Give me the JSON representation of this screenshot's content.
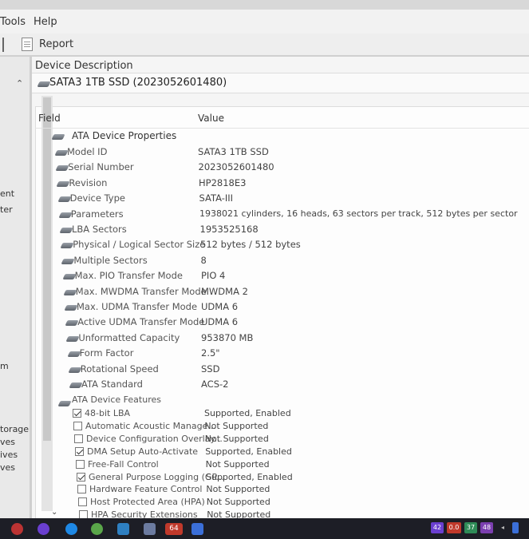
{
  "menubar": {
    "tools": "Tools",
    "help": "Help"
  },
  "toolbar": {
    "report_label": "Report"
  },
  "left_pane": {
    "fragments": [
      "ent",
      "ter",
      "m",
      "torage",
      "ves",
      "ives",
      "ves"
    ]
  },
  "device_description": {
    "title": "Device Description",
    "value": "SATA3 1TB SSD (2023052601480)"
  },
  "table": {
    "headers": {
      "field": "Field",
      "value": "Value"
    },
    "group_properties": "ATA Device Properties",
    "properties": [
      {
        "field": "Model ID",
        "value": "SATA3 1TB SSD"
      },
      {
        "field": "Serial Number",
        "value": "2023052601480"
      },
      {
        "field": "Revision",
        "value": "HP2818E3"
      },
      {
        "field": "Device Type",
        "value": "SATA-III"
      },
      {
        "field": "Parameters",
        "value": "1938021 cylinders, 16 heads, 63 sectors per track, 512 bytes per sector"
      },
      {
        "field": "LBA Sectors",
        "value": "1953525168"
      },
      {
        "field": "Physical / Logical Sector Size",
        "value": "512 bytes / 512 bytes"
      },
      {
        "field": "Multiple Sectors",
        "value": "8"
      },
      {
        "field": "Max. PIO Transfer Mode",
        "value": "PIO 4"
      },
      {
        "field": "Max. MWDMA Transfer Mode",
        "value": "MWDMA 2"
      },
      {
        "field": "Max. UDMA Transfer Mode",
        "value": "UDMA 6"
      },
      {
        "field": "Active UDMA Transfer Mode",
        "value": "UDMA 6"
      },
      {
        "field": "Unformatted Capacity",
        "value": "953870 MB"
      },
      {
        "field": "Form Factor",
        "value": "2.5\""
      },
      {
        "field": "Rotational Speed",
        "value": "SSD"
      },
      {
        "field": "ATA Standard",
        "value": "ACS-2"
      }
    ],
    "group_features": "ATA Device Features",
    "features": [
      {
        "field": "48-bit LBA",
        "value": "Supported, Enabled",
        "checked": true
      },
      {
        "field": "Automatic Acoustic Manage...",
        "value": "Not Supported",
        "checked": false
      },
      {
        "field": "Device Configuration Overlay...",
        "value": "Not Supported",
        "checked": false
      },
      {
        "field": "DMA Setup Auto-Activate",
        "value": "Supported, Enabled",
        "checked": true
      },
      {
        "field": "Free-Fall Control",
        "value": "Not Supported",
        "checked": false
      },
      {
        "field": "General Purpose Logging (GP...",
        "value": "Supported, Enabled",
        "checked": true
      },
      {
        "field": "Hardware Feature Control",
        "value": "Not Supported",
        "checked": false
      },
      {
        "field": "Host Protected Area (HPA)",
        "value": "Not Supported",
        "checked": false
      },
      {
        "field": "HPA Security Extensions",
        "value": "Not Supported",
        "checked": false
      }
    ]
  },
  "taskbar": {
    "badge_64": "64",
    "tray": [
      "42",
      "0.0",
      "37",
      "48"
    ]
  },
  "colors": {
    "taskbar_bg": "#1d1e26",
    "panel_bg": "#fdfdfd",
    "accent_blue": "#3b6fd8"
  }
}
